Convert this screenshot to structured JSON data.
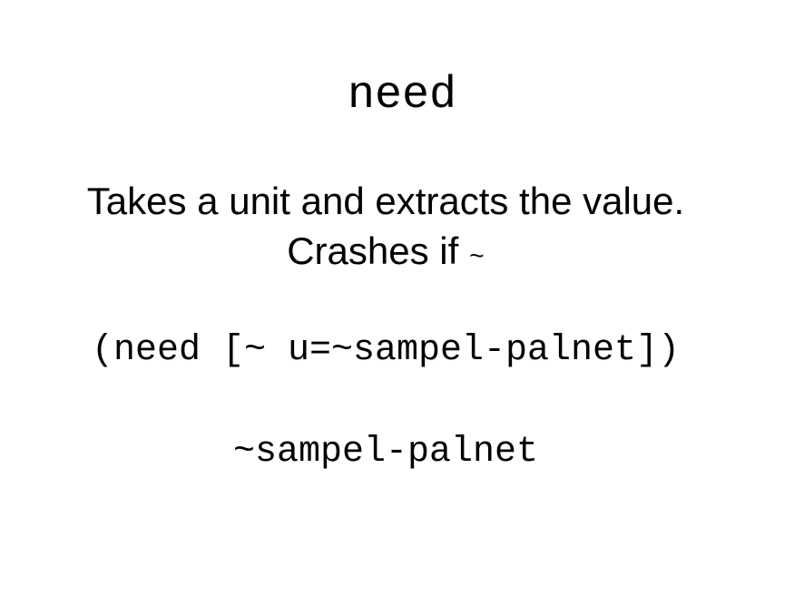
{
  "slide": {
    "title": "need",
    "description_line1": "Takes a unit and extracts the value.",
    "description_line2": "Crashes if",
    "description_tilde": "~",
    "example_input": "(need [~ u=~sampel-palnet])",
    "example_output": "~sampel-palnet"
  }
}
